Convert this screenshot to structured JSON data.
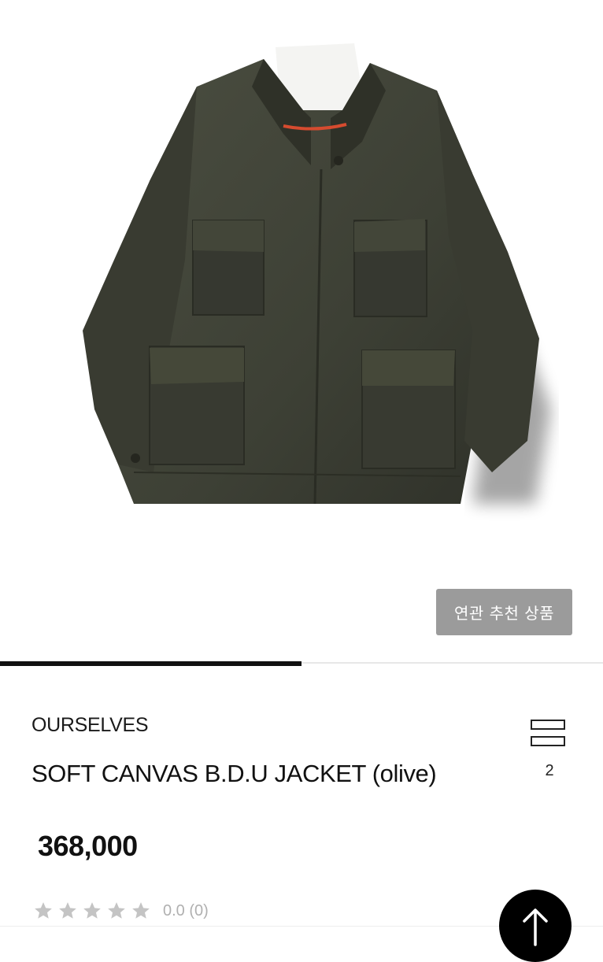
{
  "product_image": {
    "alt": "",
    "colors": {
      "jacket": "#3f4236",
      "jacket_shadow": "#2c2e25",
      "lining_tape": "#d64b2f"
    }
  },
  "related_button": {
    "label": "연관 추천 상품"
  },
  "image_carousel": {
    "progress": 0.5
  },
  "product": {
    "brand": "OURSELVES",
    "name": "SOFT CANVAS B.D.U JACKET (olive)",
    "price": "368,000"
  },
  "layout_toggle": {
    "icon": "list-layout-icon",
    "count": "2"
  },
  "rating": {
    "stars_filled": 0,
    "stars_total": 5,
    "text": "0.0 (0)"
  },
  "scroll_top_button": {
    "icon": "arrow-up-icon"
  },
  "colors": {
    "accent": "#111111",
    "button_gray": "#9b9b9b",
    "star_gray": "#c4c4c4"
  }
}
